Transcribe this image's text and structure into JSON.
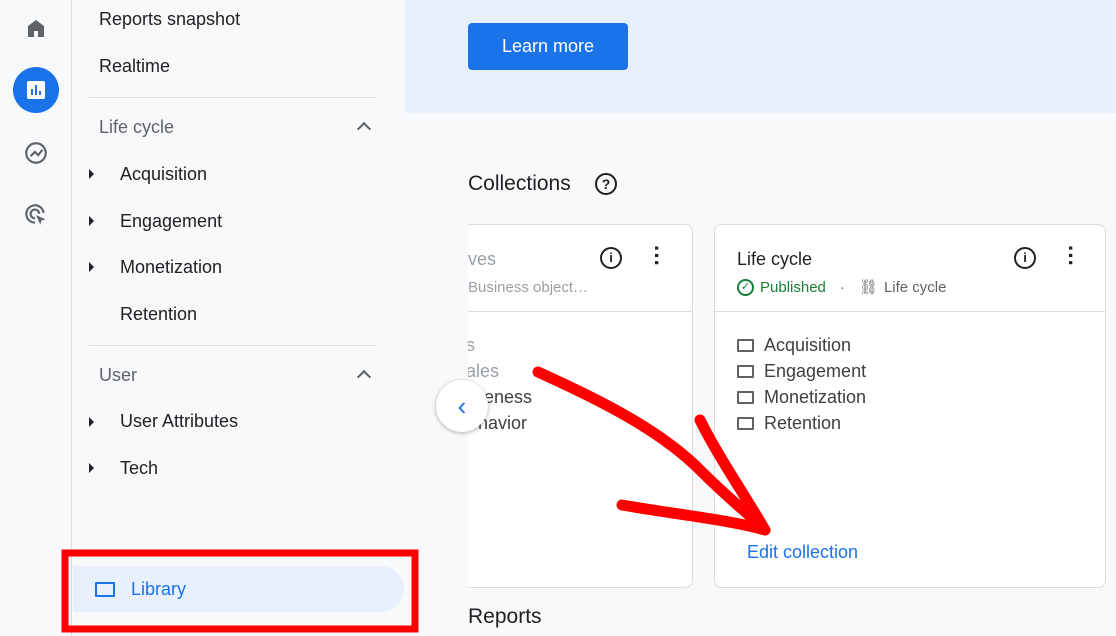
{
  "rail": {
    "items": [
      {
        "icon": "home-icon"
      },
      {
        "icon": "reports-icon",
        "active": true
      },
      {
        "icon": "explore-icon"
      },
      {
        "icon": "advertising-icon"
      }
    ]
  },
  "sidebar": {
    "top": [
      "Reports snapshot",
      "Realtime"
    ],
    "sections": [
      {
        "title": "Life cycle",
        "items": [
          "Acquisition",
          "Engagement",
          "Monetization",
          "Retention"
        ]
      },
      {
        "title": "User",
        "items": [
          "User Attributes",
          "Tech"
        ]
      }
    ],
    "library": "Library"
  },
  "banner": {
    "button": "Learn more"
  },
  "collections": {
    "title": "Collections",
    "cards": [
      {
        "title": "ves",
        "subtitle": "Business object…",
        "items": [
          "s",
          "ales",
          "areness",
          "ehavior"
        ]
      },
      {
        "title": "Life cycle",
        "status": "Published",
        "status_color": "#188038",
        "template": "Life cycle",
        "items": [
          "Acquisition",
          "Engagement",
          "Monetization",
          "Retention"
        ],
        "action": "Edit collection"
      }
    ]
  },
  "reports_title": "Reports",
  "colors": {
    "accent": "#1a73e8",
    "annotation": "#ff0000"
  }
}
